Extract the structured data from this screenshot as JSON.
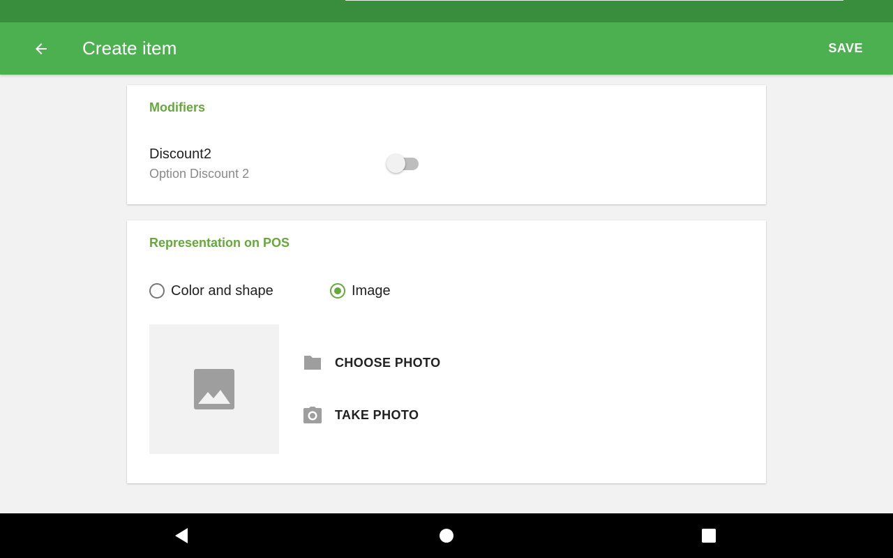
{
  "app_bar": {
    "title": "Create item",
    "save_label": "SAVE",
    "back_icon": "arrow-back-icon"
  },
  "modifiers": {
    "section_title": "Modifiers",
    "items": [
      {
        "name": "Discount2",
        "options": "Option Discount 2",
        "enabled": false
      }
    ]
  },
  "representation": {
    "section_title": "Representation on POS",
    "options": [
      {
        "label": "Color and shape",
        "selected": false
      },
      {
        "label": "Image",
        "selected": true
      }
    ],
    "image_placeholder_icon": "image-icon",
    "actions": [
      {
        "label": "CHOOSE PHOTO",
        "icon": "folder-icon"
      },
      {
        "label": "TAKE PHOTO",
        "icon": "camera-icon"
      }
    ]
  },
  "colors": {
    "status_bar": "#388e3c",
    "app_bar": "#4caf50",
    "accent": "#66a83b",
    "background": "#f2f2f2"
  },
  "nav_bar": {
    "buttons": [
      "nav-back-icon",
      "nav-home-icon",
      "nav-recents-icon"
    ]
  }
}
